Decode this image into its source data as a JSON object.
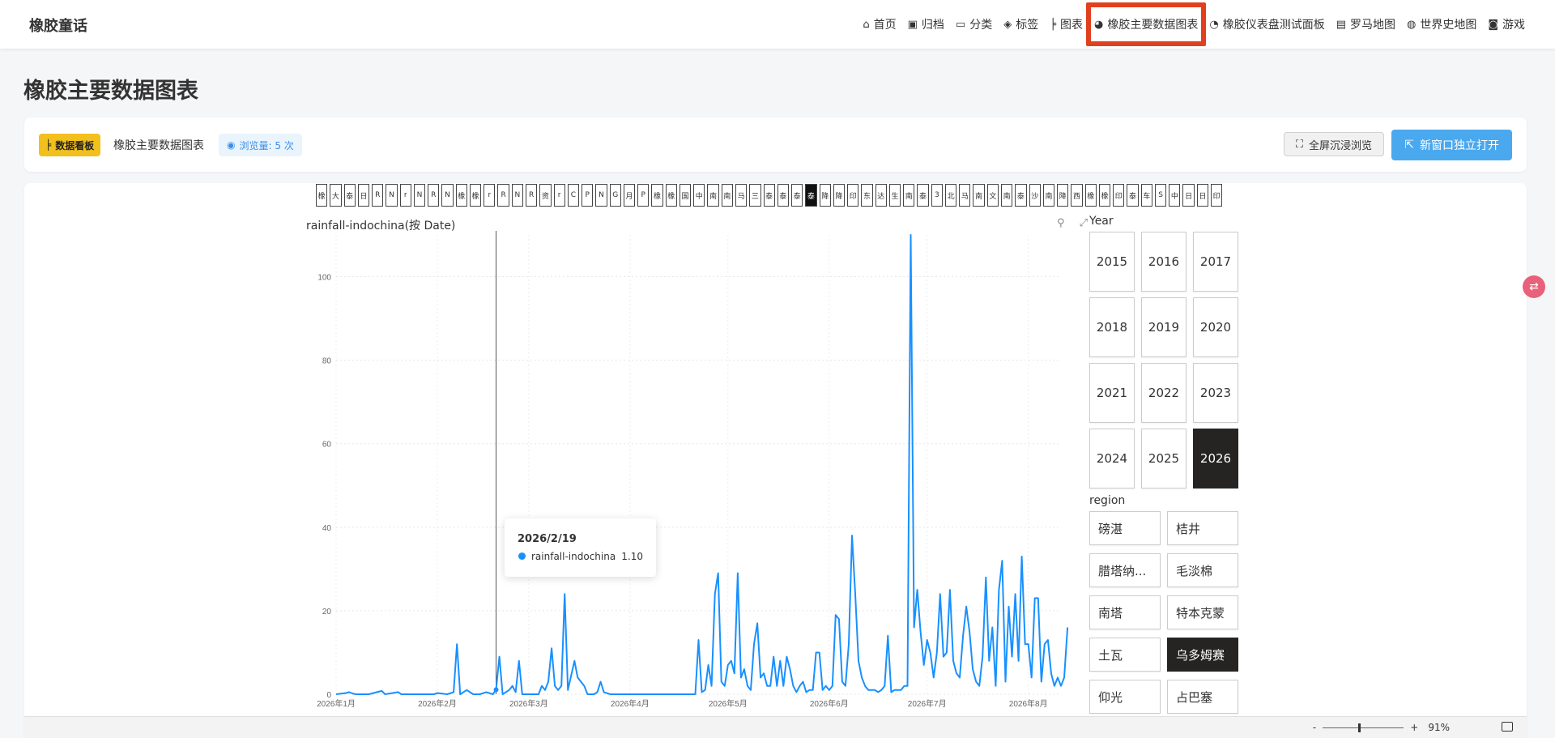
{
  "brand": "橡胶童话",
  "nav": [
    {
      "icon": "⌂",
      "label": "首页",
      "name": "home"
    },
    {
      "icon": "▣",
      "label": "归档",
      "name": "archive"
    },
    {
      "icon": "▭",
      "label": "分类",
      "name": "category"
    },
    {
      "icon": "◈",
      "label": "标签",
      "name": "tags"
    },
    {
      "icon": "╞",
      "label": "图表",
      "name": "charts"
    },
    {
      "icon": "◕",
      "label": "橡胶主要数据图表",
      "name": "rubber-main-charts"
    },
    {
      "icon": "◔",
      "label": "橡胶仪表盘测试面板",
      "name": "rubber-dashboard-test"
    },
    {
      "icon": "▤",
      "label": "罗马地图",
      "name": "rome-map"
    },
    {
      "icon": "◍",
      "label": "世界史地图",
      "name": "world-history-map"
    },
    {
      "icon": "◙",
      "label": "游戏",
      "name": "games"
    }
  ],
  "page_title": "橡胶主要数据图表",
  "panel": {
    "badge": "数据看板",
    "title": "橡胶主要数据图表",
    "views": "浏览量: 5 次",
    "fullscreen_btn": "全屏沉浸浏览",
    "newwindow_btn": "新窗口独立打开"
  },
  "tabs": [
    "橡",
    "大",
    "泰",
    "日",
    "R",
    "N",
    "r",
    "N",
    "R",
    "N",
    "橡",
    "橡",
    "r",
    "R",
    "N",
    "R",
    "资",
    "r",
    "C",
    "P",
    "N",
    "G",
    "月",
    "P",
    "橡",
    "橡",
    "国",
    "中",
    "南",
    "南",
    "马",
    "三",
    "泰",
    "泰",
    "泰",
    "泰",
    "降",
    "降",
    "印",
    "东",
    "达",
    "生",
    "南",
    "泰",
    "3",
    "北",
    "马",
    "南",
    "文",
    "南",
    "泰",
    "沙",
    "南",
    "降",
    "西",
    "橡",
    "橡",
    "印",
    "泰",
    "车",
    "S",
    "中",
    "日",
    "日",
    "印"
  ],
  "tabs_active_index": 35,
  "chart_title": "rainfall-indochina(按 Date)",
  "chart_tools": {
    "filter": "⚲",
    "expand": "⤢"
  },
  "tooltip": {
    "date": "2026/2/19",
    "series": "rainfall-indochina",
    "value": "1.10"
  },
  "slicers": {
    "year_label": "Year",
    "years": [
      "2015",
      "2016",
      "2017",
      "2018",
      "2019",
      "2020",
      "2021",
      "2022",
      "2023",
      "2024",
      "2025",
      "2026"
    ],
    "year_selected": "2026",
    "region_label": "region",
    "regions": [
      "磅湛",
      "桔井",
      "腊塔纳...",
      "毛淡棉",
      "南塔",
      "特本克蒙",
      "土瓦",
      "乌多姆赛",
      "仰光",
      "占巴塞"
    ],
    "region_selected": "乌多姆赛"
  },
  "zoom": {
    "minus": "-",
    "plus": "+",
    "level": "91%"
  },
  "chart_data": {
    "type": "line",
    "title": "rainfall-indochina(按 Date)",
    "xlabel": "",
    "ylabel": "",
    "ylim": [
      0,
      110
    ],
    "yticks": [
      0,
      20,
      40,
      60,
      80,
      100
    ],
    "x_tick_labels": [
      "2026年1月",
      "2026年2月",
      "2026年3月",
      "2026年4月",
      "2026年5月",
      "2026年6月",
      "2026年7月",
      "2026年8月"
    ],
    "x_range_days": [
      0,
      222
    ],
    "grid": true,
    "color": "#1890ff",
    "series": [
      {
        "name": "rainfall-indochina",
        "points": [
          [
            0,
            0
          ],
          [
            3,
            0.3
          ],
          [
            4,
            0.5
          ],
          [
            5,
            0.2
          ],
          [
            6,
            0
          ],
          [
            10,
            0
          ],
          [
            14,
            0.8
          ],
          [
            15,
            0
          ],
          [
            19,
            0.5
          ],
          [
            20,
            0
          ],
          [
            30,
            0
          ],
          [
            31,
            0.3
          ],
          [
            34,
            0
          ],
          [
            36,
            0.5
          ],
          [
            37,
            12
          ],
          [
            38,
            0
          ],
          [
            40,
            1
          ],
          [
            42,
            0
          ],
          [
            44,
            0
          ],
          [
            46,
            0.5
          ],
          [
            48,
            0
          ],
          [
            49,
            1.1
          ],
          [
            50,
            9
          ],
          [
            51,
            0
          ],
          [
            53,
            1
          ],
          [
            54,
            2
          ],
          [
            55,
            0.5
          ],
          [
            56,
            8
          ],
          [
            57,
            0
          ],
          [
            59,
            0
          ],
          [
            62,
            0
          ],
          [
            63,
            2
          ],
          [
            64,
            1
          ],
          [
            65,
            3
          ],
          [
            66,
            11
          ],
          [
            67,
            2
          ],
          [
            68,
            1
          ],
          [
            69,
            2
          ],
          [
            70,
            24
          ],
          [
            71,
            1
          ],
          [
            73,
            8
          ],
          [
            74,
            4
          ],
          [
            76,
            2
          ],
          [
            77,
            0
          ],
          [
            79,
            0
          ],
          [
            80,
            0.5
          ],
          [
            81,
            3
          ],
          [
            82,
            0.5
          ],
          [
            84,
            0
          ],
          [
            100,
            0
          ],
          [
            110,
            0
          ],
          [
            111,
            13
          ],
          [
            112,
            0.5
          ],
          [
            113,
            1
          ],
          [
            114,
            7
          ],
          [
            115,
            2
          ],
          [
            116,
            24
          ],
          [
            117,
            29
          ],
          [
            118,
            3
          ],
          [
            119,
            2
          ],
          [
            120,
            7
          ],
          [
            121,
            8
          ],
          [
            122,
            5
          ],
          [
            123,
            29
          ],
          [
            124,
            4
          ],
          [
            125,
            6
          ],
          [
            126,
            2
          ],
          [
            127,
            1
          ],
          [
            128,
            12
          ],
          [
            129,
            17
          ],
          [
            130,
            4
          ],
          [
            131,
            5
          ],
          [
            132,
            2
          ],
          [
            133,
            2
          ],
          [
            134,
            9
          ],
          [
            135,
            2
          ],
          [
            136,
            8
          ],
          [
            137,
            2
          ],
          [
            138,
            9
          ],
          [
            139,
            6
          ],
          [
            140,
            2
          ],
          [
            141,
            0.5
          ],
          [
            142,
            2
          ],
          [
            143,
            3
          ],
          [
            144,
            0.5
          ],
          [
            145,
            1
          ],
          [
            146,
            1
          ],
          [
            147,
            10
          ],
          [
            148,
            10
          ],
          [
            149,
            1
          ],
          [
            150,
            2
          ],
          [
            151,
            1
          ],
          [
            152,
            2
          ],
          [
            153,
            19
          ],
          [
            154,
            18
          ],
          [
            155,
            3
          ],
          [
            156,
            2
          ],
          [
            157,
            12
          ],
          [
            158,
            38
          ],
          [
            159,
            24
          ],
          [
            160,
            8
          ],
          [
            161,
            4
          ],
          [
            162,
            2
          ],
          [
            163,
            1
          ],
          [
            164,
            1
          ],
          [
            165,
            1
          ],
          [
            166,
            0.5
          ],
          [
            167,
            1
          ],
          [
            168,
            2
          ],
          [
            169,
            14
          ],
          [
            170,
            0.5
          ],
          [
            171,
            1
          ],
          [
            172,
            1
          ],
          [
            173,
            1
          ],
          [
            174,
            2
          ],
          [
            175,
            2
          ],
          [
            176,
            110
          ],
          [
            177,
            16
          ],
          [
            178,
            25
          ],
          [
            179,
            15
          ],
          [
            180,
            7
          ],
          [
            181,
            13
          ],
          [
            182,
            10
          ],
          [
            183,
            4
          ],
          [
            184,
            10
          ],
          [
            185,
            24
          ],
          [
            186,
            9
          ],
          [
            187,
            10
          ],
          [
            188,
            25
          ],
          [
            189,
            8
          ],
          [
            190,
            5
          ],
          [
            191,
            4
          ],
          [
            192,
            14
          ],
          [
            193,
            21
          ],
          [
            194,
            15
          ],
          [
            195,
            6
          ],
          [
            196,
            3
          ],
          [
            197,
            2
          ],
          [
            198,
            9
          ],
          [
            199,
            28
          ],
          [
            200,
            8
          ],
          [
            201,
            16
          ],
          [
            202,
            2
          ],
          [
            203,
            25
          ],
          [
            204,
            32
          ],
          [
            205,
            3
          ],
          [
            206,
            21
          ],
          [
            207,
            9
          ],
          [
            208,
            24
          ],
          [
            209,
            8
          ],
          [
            210,
            33
          ],
          [
            211,
            12
          ],
          [
            212,
            12
          ],
          [
            213,
            4
          ],
          [
            214,
            23
          ],
          [
            215,
            23
          ],
          [
            216,
            3
          ],
          [
            217,
            12
          ],
          [
            218,
            13
          ],
          [
            219,
            5
          ],
          [
            220,
            2
          ],
          [
            221,
            4
          ],
          [
            222,
            2
          ],
          [
            223,
            4
          ],
          [
            224,
            16
          ]
        ]
      }
    ],
    "tooltip_x_day": 49
  }
}
